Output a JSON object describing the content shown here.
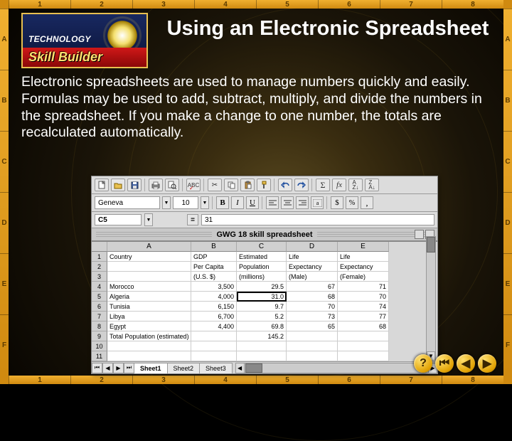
{
  "ruler": {
    "top": [
      "1",
      "2",
      "3",
      "4",
      "5",
      "6",
      "7",
      "8"
    ],
    "bottom": [
      "1",
      "2",
      "3",
      "4",
      "5",
      "6",
      "7",
      "8"
    ],
    "left": [
      "A",
      "B",
      "C",
      "D",
      "E",
      "F"
    ],
    "right": [
      "A",
      "B",
      "C",
      "D",
      "E",
      "F"
    ]
  },
  "badge": {
    "tech": "TECHNOLOGY",
    "skill": "Skill Builder"
  },
  "title": "Using an Electronic Spreadsheet",
  "body": "Electronic spreadsheets are used to manage numbers quickly and easily. Formulas may be used to add, subtract, multiply, and divide the numbers in the spreadsheet. If you make a change to one number, the totals are recalculated automatically.",
  "spreadsheet": {
    "font_name": "Geneva",
    "font_size": "10",
    "bold_label": "B",
    "italic_label": "I",
    "underline_label": "U",
    "cell_ref": "C5",
    "cell_value": "31",
    "window_title": "GWG 18 skill spreadsheet",
    "columns": [
      "A",
      "B",
      "C",
      "D",
      "E"
    ],
    "row_numbers": [
      "1",
      "2",
      "3",
      "4",
      "5",
      "6",
      "7",
      "8",
      "9",
      "10",
      "11"
    ],
    "header_rows": [
      [
        "Country",
        "GDP",
        "Estimated",
        "Life",
        "Life"
      ],
      [
        "",
        "Per Capita",
        "Population",
        "Expectancy",
        "Expectancy"
      ],
      [
        "",
        "(U.S. $)",
        "(millions)",
        "(Male)",
        "(Female)"
      ]
    ],
    "data_rows": [
      {
        "country": "Morocco",
        "gdp": "3,500",
        "pop": "29.5",
        "male": "67",
        "female": "71"
      },
      {
        "country": "Algeria",
        "gdp": "4,000",
        "pop": "31.0",
        "male": "68",
        "female": "70"
      },
      {
        "country": "Tunisia",
        "gdp": "6,150",
        "pop": "9.7",
        "male": "70",
        "female": "74"
      },
      {
        "country": "Libya",
        "gdp": "6,700",
        "pop": "5.2",
        "male": "73",
        "female": "77"
      },
      {
        "country": "Egypt",
        "gdp": "4,400",
        "pop": "69.8",
        "male": "65",
        "female": "68"
      }
    ],
    "total_row": {
      "label": "Total Population (estimated)",
      "value": "145.2"
    },
    "selected_cell": "C5",
    "sheet_tabs": [
      "Sheet1",
      "Sheet2",
      "Sheet3"
    ],
    "active_tab": 0
  },
  "nav": {
    "help": "?",
    "first": "⏮",
    "prev": "◀",
    "next": "▶"
  },
  "chart_data": {
    "type": "table",
    "title": "GWG 18 skill spreadsheet",
    "columns": [
      "Country",
      "GDP Per Capita (U.S. $)",
      "Estimated Population (millions)",
      "Life Expectancy (Male)",
      "Life Expectancy (Female)"
    ],
    "rows": [
      [
        "Morocco",
        3500,
        29.5,
        67,
        71
      ],
      [
        "Algeria",
        4000,
        31.0,
        68,
        70
      ],
      [
        "Tunisia",
        6150,
        9.7,
        70,
        74
      ],
      [
        "Libya",
        6700,
        5.2,
        73,
        77
      ],
      [
        "Egypt",
        4400,
        69.8,
        65,
        68
      ]
    ],
    "totals": {
      "Estimated Population (millions)": 145.2
    }
  }
}
